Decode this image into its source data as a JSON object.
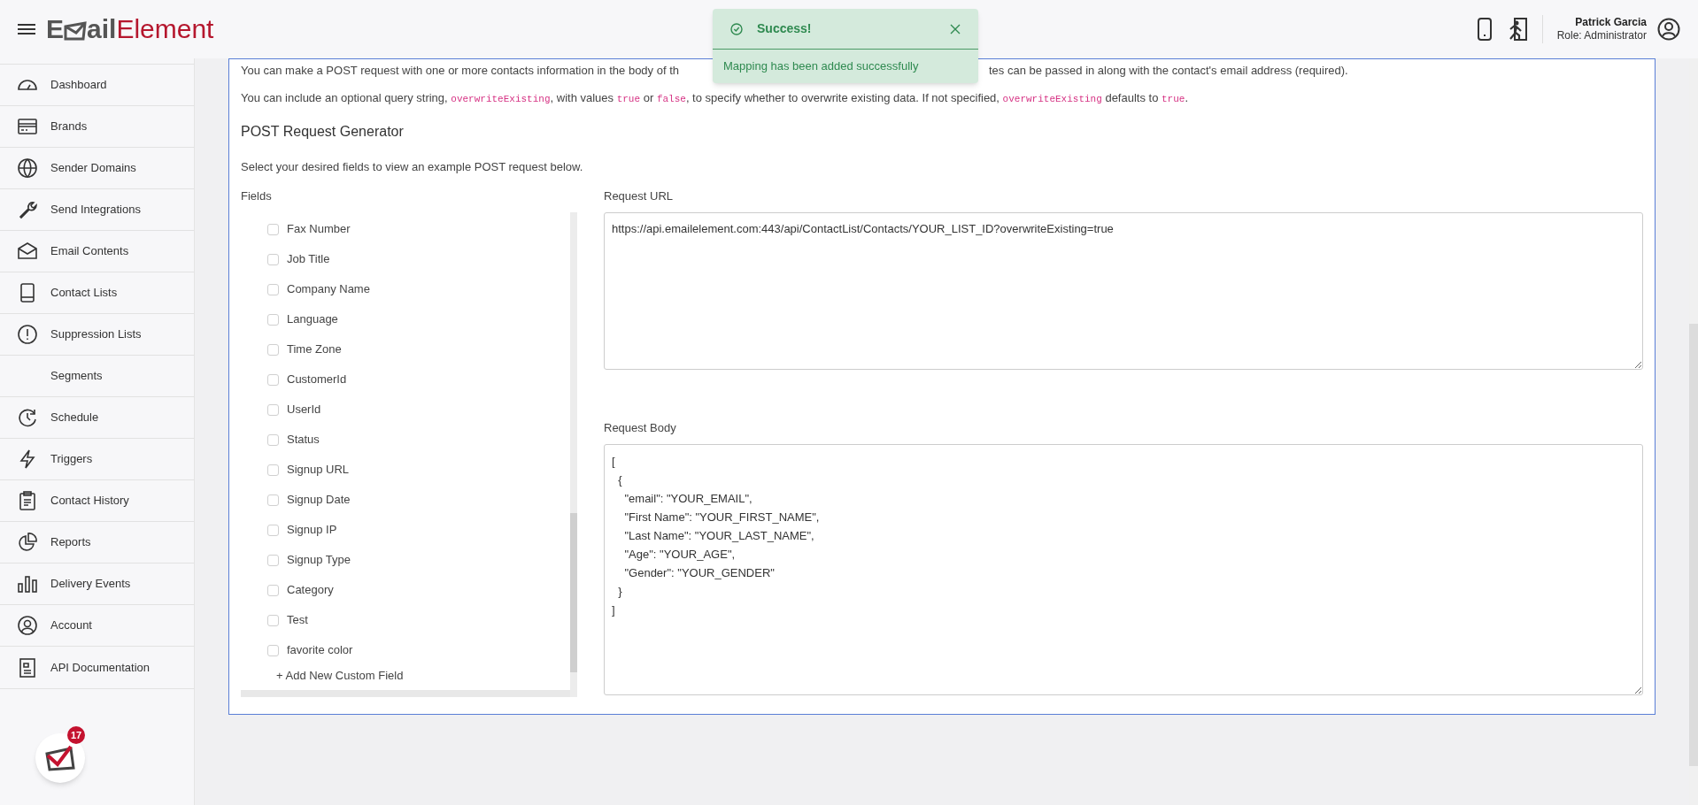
{
  "header": {
    "logo_prefix": "E",
    "logo_mid": "ail",
    "logo_suffix": "Element",
    "user_name": "Patrick Garcia",
    "user_role": "Role: Administrator"
  },
  "sidebar": {
    "items": [
      {
        "label": "Dashboard"
      },
      {
        "label": "Brands"
      },
      {
        "label": "Sender Domains"
      },
      {
        "label": "Send Integrations"
      },
      {
        "label": "Email Contents"
      },
      {
        "label": "Contact Lists"
      },
      {
        "label": "Suppression Lists"
      },
      {
        "label": "Segments"
      },
      {
        "label": "Schedule"
      },
      {
        "label": "Triggers"
      },
      {
        "label": "Contact History"
      },
      {
        "label": "Reports"
      },
      {
        "label": "Delivery Events"
      },
      {
        "label": "Account"
      },
      {
        "label": "API Documentation"
      }
    ],
    "badge_count": "17"
  },
  "intro_line_left": "You can make a POST request with one or more contacts information in the body of th",
  "intro_line_right": "tes can be passed in along with the contact's email address (required).",
  "query_line": [
    {
      "kind": "text",
      "text": "You can include an optional query string, "
    },
    {
      "kind": "code",
      "text": "overwriteExisting"
    },
    {
      "kind": "text",
      "text": ", with values "
    },
    {
      "kind": "code",
      "text": "true"
    },
    {
      "kind": "text",
      "text": " or "
    },
    {
      "kind": "code",
      "text": "false"
    },
    {
      "kind": "text",
      "text": ", to specify whether to overwrite existing data. If not specified, "
    },
    {
      "kind": "code",
      "text": "overwriteExisting"
    },
    {
      "kind": "text",
      "text": " defaults to "
    },
    {
      "kind": "code",
      "text": "true"
    },
    {
      "kind": "text",
      "text": "."
    }
  ],
  "generator": {
    "title": "POST Request Generator",
    "hint": "Select your desired fields to view an example POST request below.",
    "fields_label": "Fields",
    "fields": [
      {
        "label": "Fax Number",
        "checked": false
      },
      {
        "label": "Job Title",
        "checked": false
      },
      {
        "label": "Company Name",
        "checked": false
      },
      {
        "label": "Language",
        "checked": false
      },
      {
        "label": "Time Zone",
        "checked": false
      },
      {
        "label": "CustomerId",
        "checked": false
      },
      {
        "label": "UserId",
        "checked": false
      },
      {
        "label": "Status",
        "checked": false
      },
      {
        "label": "Signup URL",
        "checked": false
      },
      {
        "label": "Signup Date",
        "checked": false
      },
      {
        "label": "Signup IP",
        "checked": false
      },
      {
        "label": "Signup Type",
        "checked": false
      },
      {
        "label": "Category",
        "checked": false
      },
      {
        "label": "Test",
        "checked": false
      },
      {
        "label": "favorite color",
        "checked": false
      }
    ],
    "add_field": "+ Add New Custom Field",
    "url_label": "Request URL",
    "url_value": "https://api.emailelement.com:443/api/ContactList/Contacts/YOUR_LIST_ID?overwriteExisting=true",
    "body_label": "Request Body",
    "body_value": "[\n  {\n    \"email\": \"YOUR_EMAIL\",\n    \"First Name\": \"YOUR_FIRST_NAME\",\n    \"Last Name\": \"YOUR_LAST_NAME\",\n    \"Age\": \"YOUR_AGE\",\n    \"Gender\": \"YOUR_GENDER\"\n  }\n]"
  },
  "toast": {
    "title": "Success!",
    "message": "Mapping has been added successfully"
  }
}
